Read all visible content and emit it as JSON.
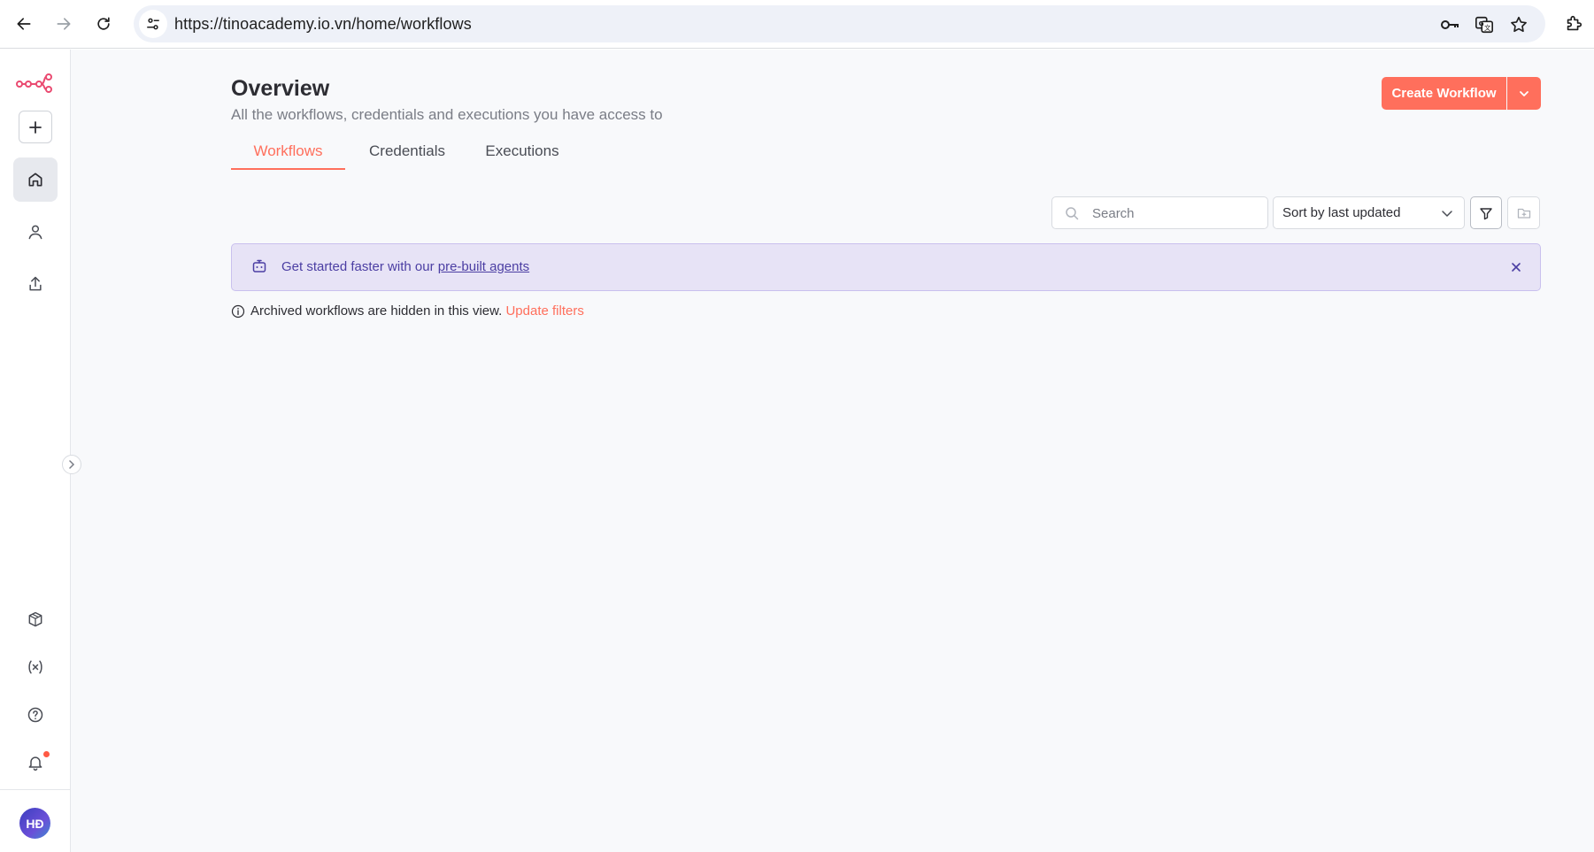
{
  "browser": {
    "url": "https://tinoacademy.io.vn/home/workflows",
    "back_icon": "arrow-left-icon",
    "forward_icon": "arrow-right-icon",
    "reload_icon": "reload-icon"
  },
  "sidebar": {
    "logo_icon": "n8n-logo-icon",
    "add_icon": "plus-icon",
    "items_top": [
      {
        "name": "home",
        "icon": "home-icon",
        "active": true
      },
      {
        "name": "personal",
        "icon": "user-icon",
        "active": false
      },
      {
        "name": "shared",
        "icon": "share-icon",
        "active": false
      }
    ],
    "items_bottom": [
      {
        "name": "templates",
        "icon": "box-icon"
      },
      {
        "name": "variables",
        "icon": "variables-icon"
      },
      {
        "name": "help",
        "icon": "help-icon"
      },
      {
        "name": "notifications",
        "icon": "bell-icon"
      }
    ],
    "avatar_initials": "HĐ"
  },
  "header": {
    "title": "Overview",
    "subtitle": "All the workflows, credentials and executions you have access to",
    "create_label": "Create Workflow"
  },
  "tabs": [
    {
      "label": "Workflows",
      "active": true
    },
    {
      "label": "Credentials",
      "active": false
    },
    {
      "label": "Executions",
      "active": false
    }
  ],
  "toolbar": {
    "search_placeholder": "Search",
    "sort_value": "Sort by last updated"
  },
  "banner": {
    "text": "Get started faster with our ",
    "link": "pre-built agents"
  },
  "notice": {
    "text": "Archived workflows are hidden in this view.",
    "link": "Update filters"
  },
  "colors": {
    "accent": "#ff6f5c",
    "banner_bg": "#e7e3f6",
    "banner_text": "#4b3ea3"
  }
}
